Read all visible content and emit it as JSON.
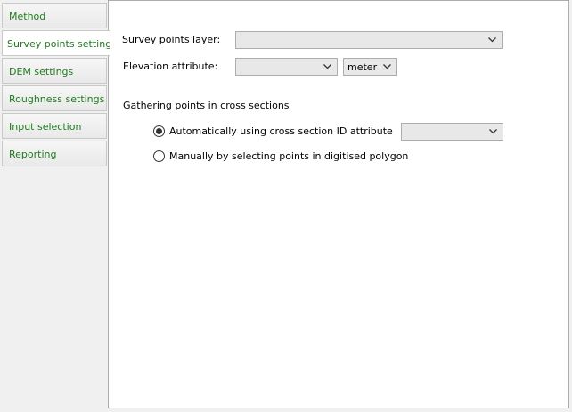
{
  "sidebar": {
    "items": [
      {
        "label": "Method"
      },
      {
        "label": "Survey points settings"
      },
      {
        "label": "DEM settings"
      },
      {
        "label": "Roughness settings"
      },
      {
        "label": "Input selection"
      },
      {
        "label": "Reporting"
      }
    ],
    "active_index": 1
  },
  "form": {
    "survey_layer": {
      "label": "Survey points layer:",
      "value": ""
    },
    "elevation": {
      "label": "Elevation attribute:",
      "value": "",
      "unit": "meter"
    },
    "gathering": {
      "title": "Gathering points in cross sections",
      "auto": {
        "label": "Automatically using cross section ID attribute",
        "selected": true,
        "attribute_value": ""
      },
      "manual": {
        "label": "Manually by selecting points in digitised polygon",
        "selected": false
      }
    }
  },
  "colors": {
    "tab_text": "#1f7a1f",
    "panel_bg": "#ffffff",
    "window_bg": "#f0f0f0",
    "combo_bg": "#e8e8e8"
  }
}
